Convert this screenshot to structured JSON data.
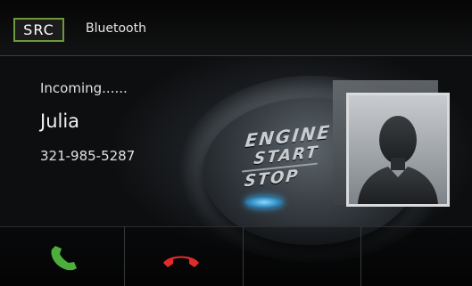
{
  "header": {
    "src_label": "SRC",
    "source_title": "Bluetooth"
  },
  "call": {
    "status": "Incoming......",
    "caller_name": "Julia",
    "caller_number": "321-985-5287"
  },
  "background_button": {
    "line1": "ENGINE",
    "line2": "START",
    "line3": "STOP"
  },
  "bottom_bar": {
    "buttons": [
      {
        "icon": "accept-call-icon",
        "color": "#4caf3c"
      },
      {
        "icon": "reject-call-icon",
        "color": "#e02b2b"
      },
      {
        "icon": "",
        "color": ""
      },
      {
        "icon": "",
        "color": ""
      }
    ]
  },
  "colors": {
    "accent_green": "#6b9a3c",
    "accept": "#4caf3c",
    "reject": "#e02b2b"
  }
}
